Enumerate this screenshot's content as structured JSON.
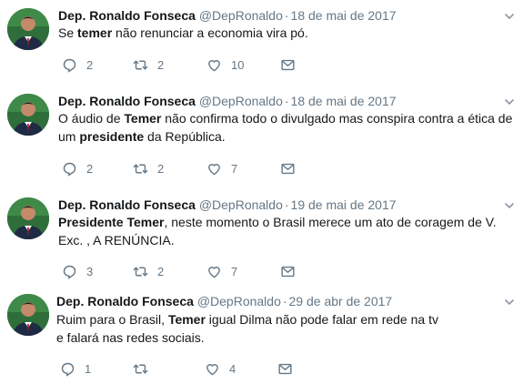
{
  "tweets": [
    {
      "name": "Dep. Ronaldo Fonseca",
      "handle": "@DepRonaldo",
      "separator": "·",
      "date": "18 de mai de 2017",
      "parts": [
        {
          "text": "Se ",
          "bold": false
        },
        {
          "text": "temer",
          "bold": true
        },
        {
          "text": " não renunciar a economia vira pó.",
          "bold": false
        }
      ],
      "replies": "2",
      "retweets": "2",
      "likes": "10"
    },
    {
      "name": "Dep. Ronaldo Fonseca",
      "handle": "@DepRonaldo",
      "separator": "·",
      "date": "18 de mai de 2017",
      "parts": [
        {
          "text": "O áudio de ",
          "bold": false
        },
        {
          "text": "Temer",
          "bold": true
        },
        {
          "text": " não confirma todo o divulgado mas conspira contra a ética de um ",
          "bold": false
        },
        {
          "text": "presidente",
          "bold": true
        },
        {
          "text": " da República.",
          "bold": false
        }
      ],
      "replies": "2",
      "retweets": "2",
      "likes": "7"
    },
    {
      "name": "Dep. Ronaldo Fonseca",
      "handle": "@DepRonaldo",
      "separator": "·",
      "date": "19 de mai de 2017",
      "parts": [
        {
          "text": "Presidente Temer",
          "bold": true
        },
        {
          "text": ", neste momento o Brasil merece um ato de coragem de V. Exc. , A RENÚNCIA.",
          "bold": false
        }
      ],
      "replies": "3",
      "retweets": "2",
      "likes": "7"
    },
    {
      "name": "Dep. Ronaldo Fonseca",
      "handle": "@DepRonaldo",
      "separator": "·",
      "date": "29 de abr de 2017",
      "parts": [
        {
          "text": "Ruim para o Brasil, ",
          "bold": false
        },
        {
          "text": "Temer",
          "bold": true
        },
        {
          "text": " igual Dilma não pode falar em rede na tv e falará nas redes sociais.",
          "bold": false
        }
      ],
      "replies": "1",
      "retweets": "",
      "likes": "4"
    }
  ],
  "icons": {
    "reply": "reply-icon",
    "retweet": "retweet-icon",
    "like": "heart-icon",
    "dm": "envelope-icon",
    "menu": "chevron-down-icon"
  },
  "colors": {
    "name": "#14171a",
    "meta": "#657786",
    "icon": "#657786",
    "avatar_bg": "#2f6e3a"
  }
}
